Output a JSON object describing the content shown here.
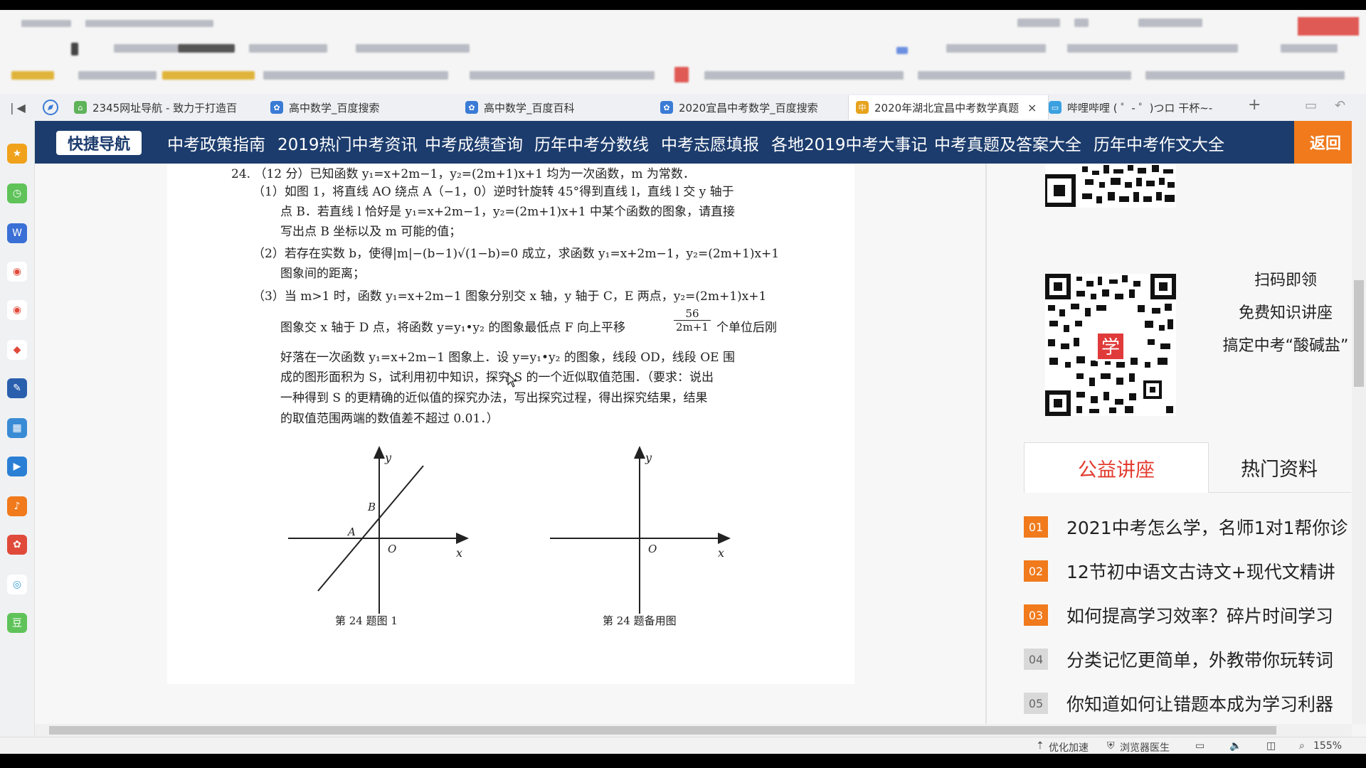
{
  "tabs": [
    {
      "title": "2345网址导航 - 致力于打造百",
      "icon": "house-icon"
    },
    {
      "title": "高中数学_百度搜索",
      "icon": "paw-icon"
    },
    {
      "title": "高中数学_百度百科",
      "icon": "paw-icon"
    },
    {
      "title": "2020宜昌中考数学_百度搜索",
      "icon": "paw-icon"
    },
    {
      "title": "2020年湖北宜昌中考数学真题",
      "icon": "page-icon",
      "active": true,
      "close": "×"
    },
    {
      "title": "哔哩哔哩 ( ゜- ゜)つロ 干杯~-b",
      "icon": "tv-icon"
    }
  ],
  "new_tab": "+",
  "navbar": {
    "badge": "快捷导航",
    "links": [
      "中考政策指南",
      "2019热门中考资讯",
      "中考成绩查询",
      "历年中考分数线",
      "中考志愿填报",
      "各地2019中考大事记",
      "中考真题及答案大全",
      "历年中考作文大全"
    ],
    "back": "返回"
  },
  "doc": {
    "lines": [
      "24. （12 分）已知函数 y₁=x+2m−1，y₂=(2m+1)x+1 均为一次函数，m 为常数．",
      "（1）如图 1，将直线 AO 绕点 A（−1，0）逆时针旋转 45°得到直线 l，直线 l 交 y 轴于",
      "点 B．若直线 l 恰好是 y₁=x+2m−1，y₂=(2m+1)x+1 中某个函数的图象，请直接",
      "写出点 B 坐标以及 m 可能的值；",
      "（2）若存在实数 b，使得|m|−(b−1)√(1−b)=0 成立，求函数 y₁=x+2m−1，y₂=(2m+1)x+1",
      "图象间的距离；",
      "（3）当 m>1 时，函数 y₁=x+2m−1 图象分别交 x 轴，y 轴于 C，E 两点，y₂=(2m+1)x+1",
      "图象交 x 轴于 D 点，将函数 y=y₁•y₂ 的图象最低点 F 向上平移",
      "个单位后刚",
      "好落在一次函数 y₁=x+2m−1 图象上．设 y=y₁•y₂ 的图象，线段 OD，线段 OE 围",
      "成的图形面积为 S，试利用初中知识，探究 S 的一个近似取值范围．（要求：说出",
      "一种得到 S 的更精确的近似值的探究办法，写出探究过程，得出探究结果，结果",
      "的取值范围两端的数值差不超过 0.01．）"
    ],
    "frac_num": "56",
    "frac_den": "2m+1",
    "fig1": {
      "caption": "第 24 题图 1",
      "y": "y",
      "x": "x",
      "o": "O",
      "a": "A",
      "b": "B"
    },
    "fig2": {
      "caption": "第 24 题备用图",
      "y": "y",
      "x": "x",
      "o": "O"
    }
  },
  "promo": {
    "lines": [
      "扫码即领",
      "免费知识讲座",
      "搞定中考“酸碱盐”"
    ],
    "qr_badge": "学"
  },
  "panel_tabs": [
    "公益讲座",
    "热门资料"
  ],
  "list": [
    {
      "num": "01",
      "text": "2021中考怎么学，名师1对1帮你诊",
      "color": "#f07a1c"
    },
    {
      "num": "02",
      "text": "12节初中语文古诗文+现代文精讲",
      "color": "#f07a1c"
    },
    {
      "num": "03",
      "text": "如何提高学习效率？碎片时间学习",
      "color": "#f07a1c"
    },
    {
      "num": "04",
      "text": "分类记忆更简单，外教带你玩转词",
      "color": "#d9d9d9"
    },
    {
      "num": "05",
      "text": "你知道如何让错题本成为学习利器",
      "color": "#d9d9d9"
    }
  ],
  "status": {
    "speed": "优化加速",
    "doctor": "浏览器医生",
    "zoom": "155%"
  },
  "colors": {
    "navbar": "#1c3c6d",
    "accent": "#f07a1c",
    "tab_active_text": "#e23b2e"
  }
}
